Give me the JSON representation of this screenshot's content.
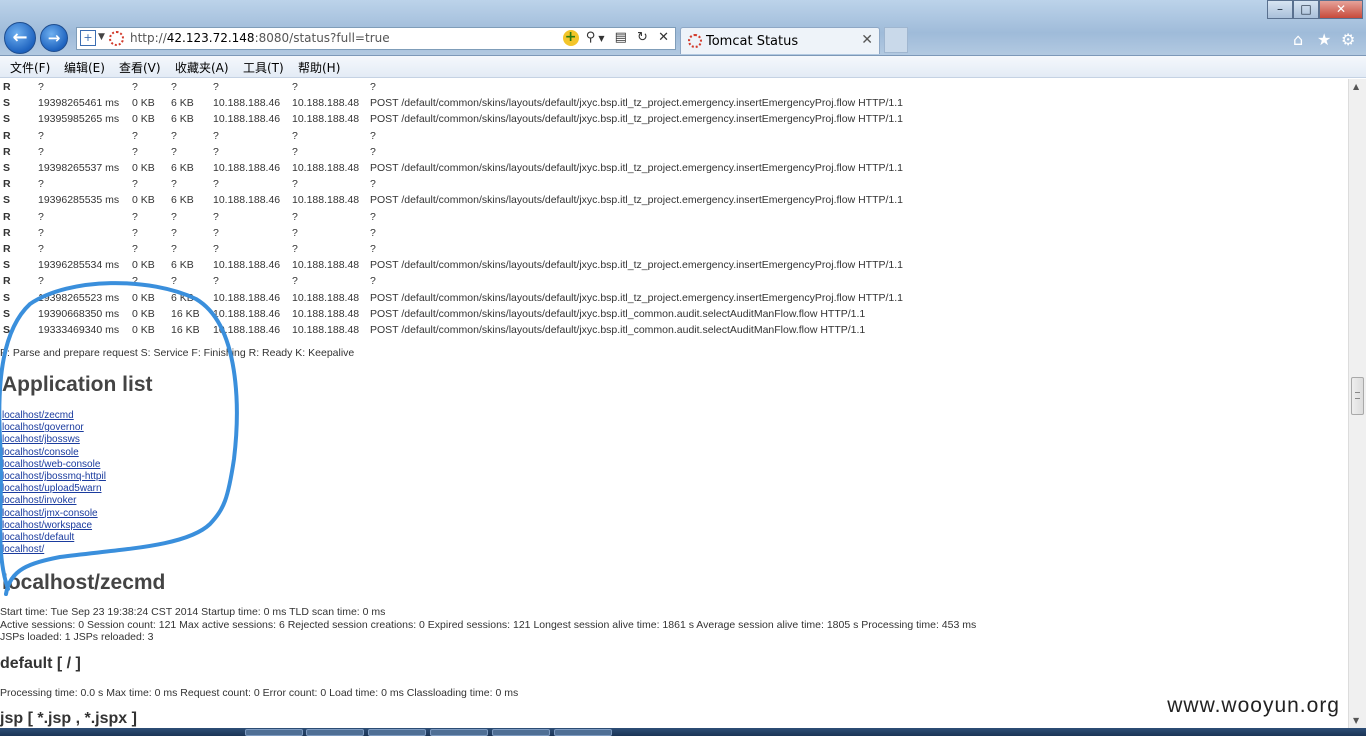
{
  "browser": {
    "url_prefix": "http://",
    "url_host": "42.123.72.148",
    "url_rest": ":8080/status?full=true",
    "tab_title": "Tomcat Status",
    "menu": [
      "文件(F)",
      "编辑(E)",
      "查看(V)",
      "收藏夹(A)",
      "工具(T)",
      "帮助(H)"
    ]
  },
  "threads": [
    {
      "stage": "R",
      "time": "?",
      "bsent": "?",
      "brecv": "?",
      "client": "?",
      "vhost": "?",
      "request": "?"
    },
    {
      "stage": "S",
      "time": "19398265461 ms",
      "bsent": "0 KB",
      "brecv": "6 KB",
      "client": "10.188.188.46",
      "vhost": "10.188.188.48",
      "request": "POST /default/common/skins/layouts/default/jxyc.bsp.itl_tz_project.emergency.insertEmergencyProj.flow HTTP/1.1"
    },
    {
      "stage": "S",
      "time": "19395985265 ms",
      "bsent": "0 KB",
      "brecv": "6 KB",
      "client": "10.188.188.46",
      "vhost": "10.188.188.48",
      "request": "POST /default/common/skins/layouts/default/jxyc.bsp.itl_tz_project.emergency.insertEmergencyProj.flow HTTP/1.1"
    },
    {
      "stage": "R",
      "time": "?",
      "bsent": "?",
      "brecv": "?",
      "client": "?",
      "vhost": "?",
      "request": "?"
    },
    {
      "stage": "R",
      "time": "?",
      "bsent": "?",
      "brecv": "?",
      "client": "?",
      "vhost": "?",
      "request": "?"
    },
    {
      "stage": "S",
      "time": "19398265537 ms",
      "bsent": "0 KB",
      "brecv": "6 KB",
      "client": "10.188.188.46",
      "vhost": "10.188.188.48",
      "request": "POST /default/common/skins/layouts/default/jxyc.bsp.itl_tz_project.emergency.insertEmergencyProj.flow HTTP/1.1"
    },
    {
      "stage": "R",
      "time": "?",
      "bsent": "?",
      "brecv": "?",
      "client": "?",
      "vhost": "?",
      "request": "?"
    },
    {
      "stage": "S",
      "time": "19396285535 ms",
      "bsent": "0 KB",
      "brecv": "6 KB",
      "client": "10.188.188.46",
      "vhost": "10.188.188.48",
      "request": "POST /default/common/skins/layouts/default/jxyc.bsp.itl_tz_project.emergency.insertEmergencyProj.flow HTTP/1.1"
    },
    {
      "stage": "R",
      "time": "?",
      "bsent": "?",
      "brecv": "?",
      "client": "?",
      "vhost": "?",
      "request": "?"
    },
    {
      "stage": "R",
      "time": "?",
      "bsent": "?",
      "brecv": "?",
      "client": "?",
      "vhost": "?",
      "request": "?"
    },
    {
      "stage": "R",
      "time": "?",
      "bsent": "?",
      "brecv": "?",
      "client": "?",
      "vhost": "?",
      "request": "?"
    },
    {
      "stage": "S",
      "time": "19396285534 ms",
      "bsent": "0 KB",
      "brecv": "6 KB",
      "client": "10.188.188.46",
      "vhost": "10.188.188.48",
      "request": "POST /default/common/skins/layouts/default/jxyc.bsp.itl_tz_project.emergency.insertEmergencyProj.flow HTTP/1.1"
    },
    {
      "stage": "R",
      "time": "?",
      "bsent": "?",
      "brecv": "?",
      "client": "?",
      "vhost": "?",
      "request": "?"
    },
    {
      "stage": "S",
      "time": "19398265523 ms",
      "bsent": "0 KB",
      "brecv": "6 KB",
      "client": "10.188.188.46",
      "vhost": "10.188.188.48",
      "request": "POST /default/common/skins/layouts/default/jxyc.bsp.itl_tz_project.emergency.insertEmergencyProj.flow HTTP/1.1"
    },
    {
      "stage": "S",
      "time": "19390668350 ms",
      "bsent": "0 KB",
      "brecv": "16 KB",
      "client": "10.188.188.46",
      "vhost": "10.188.188.48",
      "request": "POST /default/common/skins/layouts/default/jxyc.bsp.itl_common.audit.selectAuditManFlow.flow HTTP/1.1"
    },
    {
      "stage": "S",
      "time": "19333469340 ms",
      "bsent": "0 KB",
      "brecv": "16 KB",
      "client": "10.188.188.46",
      "vhost": "10.188.188.48",
      "request": "POST /default/common/skins/layouts/default/jxyc.bsp.itl_common.audit.selectAuditManFlow.flow HTTP/1.1"
    }
  ],
  "legend": "P: Parse and prepare request S: Service F: Finishing R: Ready K: Keepalive",
  "app_list_heading": "Application list",
  "app_links": [
    "localhost/zecmd",
    "localhost/governor",
    "localhost/jbossws",
    "localhost/console",
    "localhost/web-console",
    "localhost/jbossmq-httpil",
    "localhost/upload5warn",
    "localhost/invoker",
    "localhost/jmx-console",
    "localhost/workspace",
    "localhost/default",
    "localhost/"
  ],
  "app_heading": "localhost/zecmd",
  "stats": [
    "Start time: Tue Sep 23 19:38:24 CST 2014 Startup time: 0 ms TLD scan time: 0 ms",
    "Active sessions: 0 Session count: 121 Max active sessions: 6 Rejected session creations: 0 Expired sessions: 121 Longest session alive time: 1861 s Average session alive time: 1805 s Processing time: 453 ms",
    "JSPs loaded: 1 JSPs reloaded: 3"
  ],
  "default_heading": "default [ / ]",
  "default_stats": "Processing time: 0.0 s Max time: 0 ms Request count: 0 Error count: 0 Load time: 0 ms Classloading time: 0 ms",
  "jsp_heading": "jsp [ *.jsp , *.jspx ]",
  "watermark": "www.wooyun.org",
  "annotation_color": "#3a8fdc"
}
